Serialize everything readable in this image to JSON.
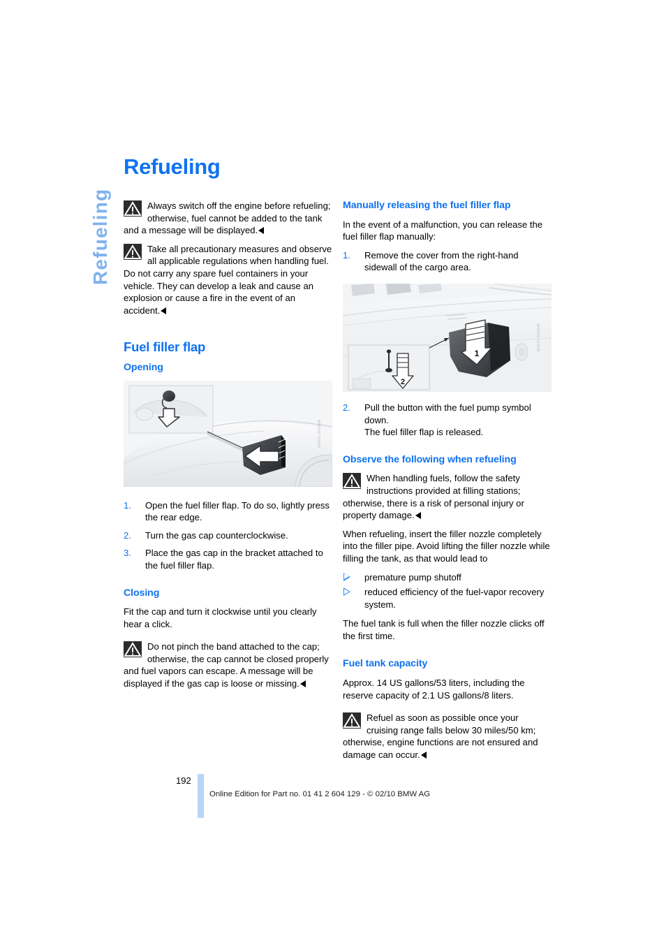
{
  "document": {
    "section_tab": "Refueling",
    "page_title": "Refueling",
    "page_number": "192",
    "footer_text": "Online Edition for Part no. 01 41 2 604 129 - © 02/10 BMW AG"
  },
  "left_column": {
    "warning_1": "Always switch off the engine before refueling; otherwise, fuel cannot be added to the tank and a message will be displayed.",
    "warning_2": "Take all precautionary measures and observe all applicable regulations when handling fuel. Do not carry any spare fuel containers in your vehicle. They can develop a leak and cause an explosion or cause a fire in the event of an accident.",
    "heading_fuel_filler_flap": "Fuel filler flap",
    "heading_opening": "Opening",
    "figure_opening_credit": "WWSHF7UHFN",
    "steps": [
      "Open the fuel filler flap. To do so, lightly press the rear edge.",
      "Turn the gas cap counterclockwise.",
      "Place the gas cap in the bracket attached to the fuel filler flap."
    ],
    "step_numbers": [
      "1.",
      "2.",
      "3."
    ],
    "heading_closing": "Closing",
    "closing_text": "Fit the cap and turn it clockwise until you clearly hear a click.",
    "warning_3": "Do not pinch the band attached to the cap; otherwise, the cap cannot be closed properly and fuel vapors can escape. A message will be displayed if the gas cap is loose or missing."
  },
  "right_column": {
    "heading_manual_release": "Manually releasing the fuel filler flap",
    "manual_release_intro": "In the event of a malfunction, you can release the fuel filler flap manually:",
    "step_1_number": "1.",
    "step_1": "Remove the cover from the right-hand sidewall of the cargo area.",
    "figure_release_credit": "WWSHF7UHFN",
    "figure_release_label_1": "1",
    "figure_release_label_2": "2",
    "step_2_number": "2.",
    "step_2_line_1": "Pull the button with the fuel pump symbol down.",
    "step_2_line_2": "The fuel filler flap is released.",
    "heading_observe": "Observe the following when refueling",
    "warning_4": "When handling fuels, follow the safety instructions provided at filling stations; otherwise, there is a risk of personal injury or property damage.",
    "refuel_paragraph": "When refueling, insert the filler nozzle completely into the filler pipe. Avoid lifting the filler nozzle while filling the tank, as that would lead to",
    "bullets": [
      "premature pump shutoff",
      "reduced efficiency of the fuel-vapor recovery system."
    ],
    "tank_full_text": "The fuel tank is full when the filler nozzle clicks off the first time.",
    "heading_capacity": "Fuel tank capacity",
    "capacity_text": "Approx. 14 US gallons/53 liters, including the reserve capacity of 2.1 US gallons/8 liters.",
    "warning_5": "Refuel as soon as possible once your cruising range falls below 30 miles/50 km; otherwise, engine functions are not ensured and damage can occur."
  },
  "colors": {
    "heading_blue": "#0f72ef",
    "tab_blue": "#7fb2ef",
    "footer_bar_blue": "#b9d4f7"
  }
}
